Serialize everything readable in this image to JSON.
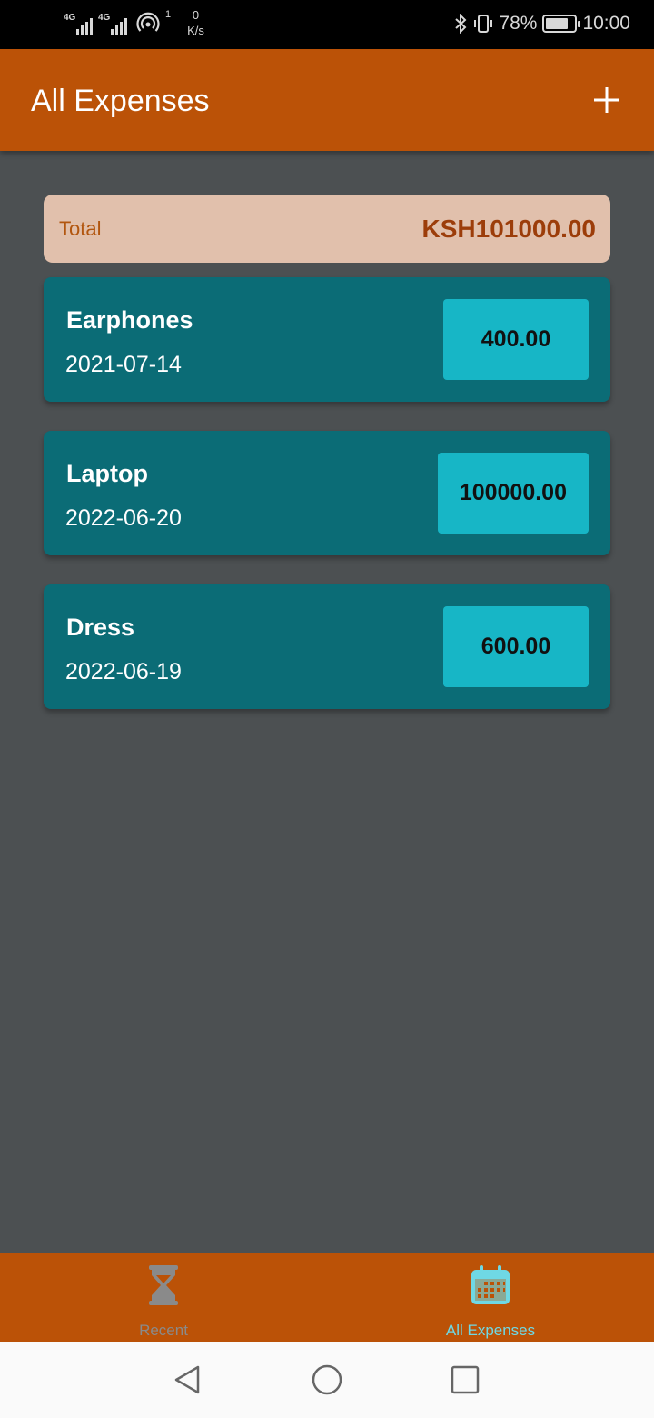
{
  "status_bar": {
    "network_left": "4G",
    "network_right": "4G",
    "hotspot_count": "1",
    "speed_value": "0",
    "speed_unit": "K/s",
    "battery": "78%",
    "time": "10:00",
    "battery_level": 0.78
  },
  "app_bar": {
    "title": "All Expenses",
    "add_icon": "plus-icon"
  },
  "total": {
    "label": "Total",
    "value": "KSH101000.00"
  },
  "expenses": [
    {
      "name": "Earphones",
      "date": "2021-07-14",
      "amount": "400.00"
    },
    {
      "name": "Laptop",
      "date": "2022-06-20",
      "amount": "100000.00"
    },
    {
      "name": "Dress",
      "date": "2022-06-19",
      "amount": "600.00"
    }
  ],
  "bottom_nav": {
    "items": [
      {
        "label": "Recent",
        "icon": "hourglass-icon",
        "active": false
      },
      {
        "label": "All Expenses",
        "icon": "calendar-icon",
        "active": true
      }
    ]
  },
  "colors": {
    "app_bar": "#bb5207",
    "background": "#4c5052",
    "card": "#0b6c76",
    "amount_box": "#17b6c6",
    "total_card": "#e1c0ac",
    "active_tab": "#6fd8e4"
  }
}
